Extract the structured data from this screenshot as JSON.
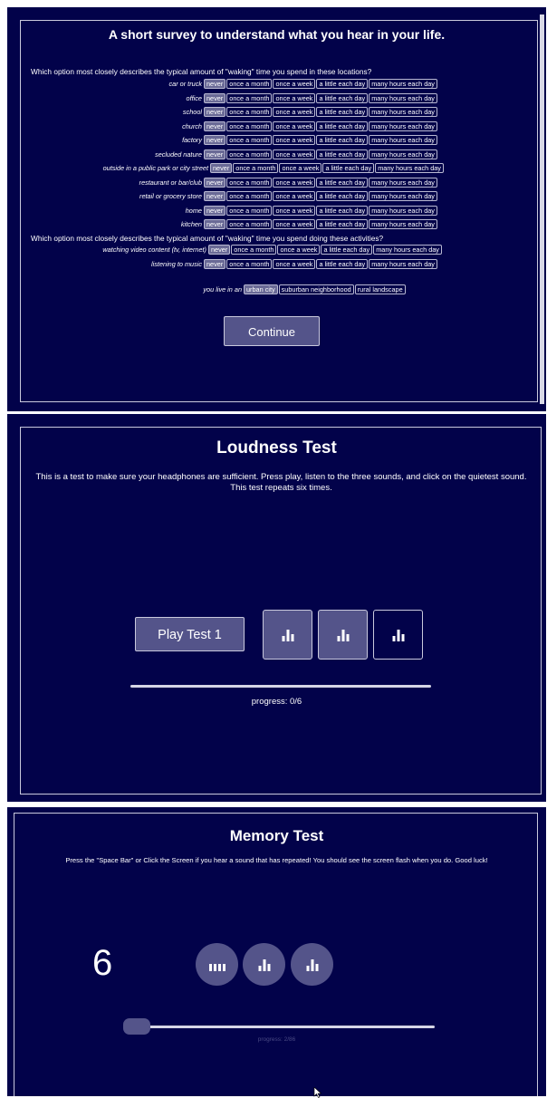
{
  "survey": {
    "title": "A short survey to understand what you hear in your life.",
    "q1": "Which option most closely describes the typical amount of \"waking\" time you spend in these locations?",
    "q2": "Which option most closely describes the typical amount of \"waking\" time you spend doing these activities?",
    "options": [
      "never",
      "once a month",
      "once a week",
      "a little each day",
      "many hours each day"
    ],
    "selected_option": "never",
    "locations": [
      "car or truck",
      "office",
      "school",
      "church",
      "factory",
      "secluded nature",
      "outside in a public park or city street",
      "restaurant or bar/club",
      "retail or grocery store",
      "home",
      "kitchen"
    ],
    "activities": [
      "watching video content (tv, internet)",
      "listening to music"
    ],
    "live_label": "you live in an",
    "live_options": [
      "urban city",
      "suburban neighborhood",
      "rural landscape"
    ],
    "live_selected": "urban city",
    "continue_label": "Continue"
  },
  "loudness": {
    "title": "Loudness Test",
    "description": "This is a test to make sure your headphones are sufficient. Press play, listen to the three sounds, and click on the quietest sound. This test repeats six times.",
    "play_label": "Play Test 1",
    "sound_icons": [
      "sound-bars-icon",
      "sound-bars-icon",
      "sound-bars-icon"
    ],
    "progress_text": "progress: 0/6",
    "progress_value": 0
  },
  "memory": {
    "title": "Memory Test",
    "description": "Press the \"Space Bar\" or Click the Screen if you hear a sound that has repeated! You should see the screen flash when you do. Good luck!",
    "count": "6",
    "sound_icons": [
      "sound-bars-icon",
      "sound-bars-icon",
      "sound-bars-icon"
    ],
    "progress_text": "progress: 2/86",
    "progress_value": 0.023
  },
  "colors": {
    "background": "#02024a",
    "button": "#54548a",
    "border": "#c9c9dd"
  }
}
